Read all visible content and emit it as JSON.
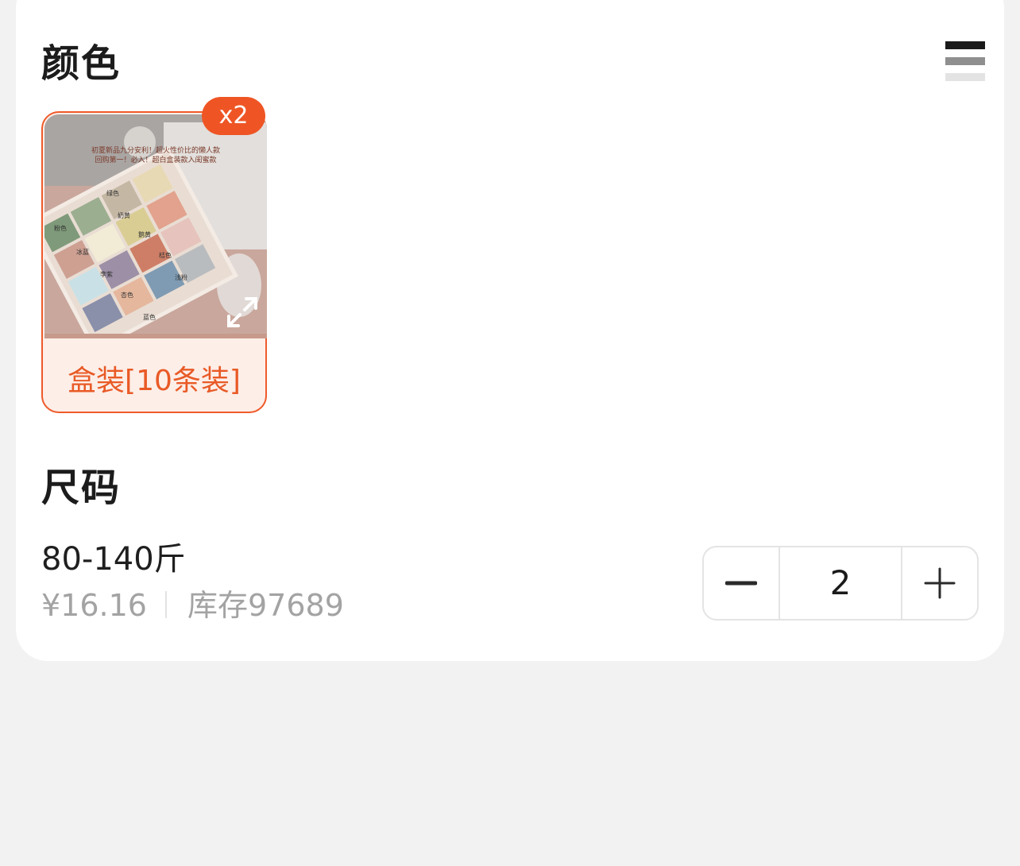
{
  "color_section": {
    "title": "颜色",
    "options": [
      {
        "label": "盒装[10条装]",
        "badge": "x2",
        "selected": true,
        "image_text": {
          "banner_line1": "初夏新品九分安利！超火性价比的懒人款",
          "banner_line2": "回购第一！必入！超白盒装款入闺蜜款",
          "swatches": [
            "绿色",
            "粉色",
            "奶黄",
            "鹅黄",
            "冰蓝",
            "桔色",
            "李紫",
            "浅粉",
            "杏色",
            "蓝色"
          ]
        }
      }
    ]
  },
  "size_section": {
    "title": "尺码",
    "item": {
      "name": "80-140斤",
      "price": "¥16.16",
      "stock": "库存97689"
    },
    "quantity": "2"
  },
  "colors": {
    "accent": "#ef5524",
    "accent_bg": "#fdeee8",
    "muted_text": "#a3a3a3",
    "page_bg": "#f2f2f2"
  },
  "icons": {
    "menu": "menu-icon",
    "expand": "expand-icon",
    "minus": "minus-icon",
    "plus": "plus-icon"
  }
}
